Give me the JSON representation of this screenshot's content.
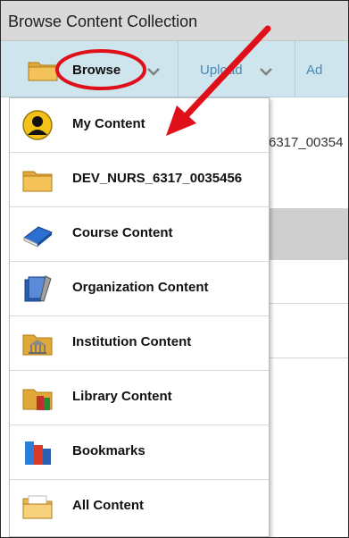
{
  "window": {
    "title": "Browse Content Collection"
  },
  "toolbar": {
    "browse_label": "Browse",
    "upload_label": "Upload",
    "add_label": "Ad"
  },
  "background": {
    "path_fragment": "6317_00354"
  },
  "menu": {
    "items": [
      {
        "label": "My Content",
        "icon": "user-icon"
      },
      {
        "label": "DEV_NURS_6317_0035456",
        "icon": "folder-icon"
      },
      {
        "label": "Course Content",
        "icon": "book-icon"
      },
      {
        "label": "Organization Content",
        "icon": "organization-icon"
      },
      {
        "label": "Institution Content",
        "icon": "institution-icon"
      },
      {
        "label": "Library Content",
        "icon": "library-icon"
      },
      {
        "label": "Bookmarks",
        "icon": "bookmarks-icon"
      },
      {
        "label": "All Content",
        "icon": "all-content-icon"
      }
    ]
  },
  "annotation": {
    "color": "#e0101a",
    "icon": "red-arrow-icon"
  },
  "colors": {
    "title_bar": "#d9d9d9",
    "toolbar": "#cfe5ee",
    "toolbar_link": "#4a86b2"
  }
}
